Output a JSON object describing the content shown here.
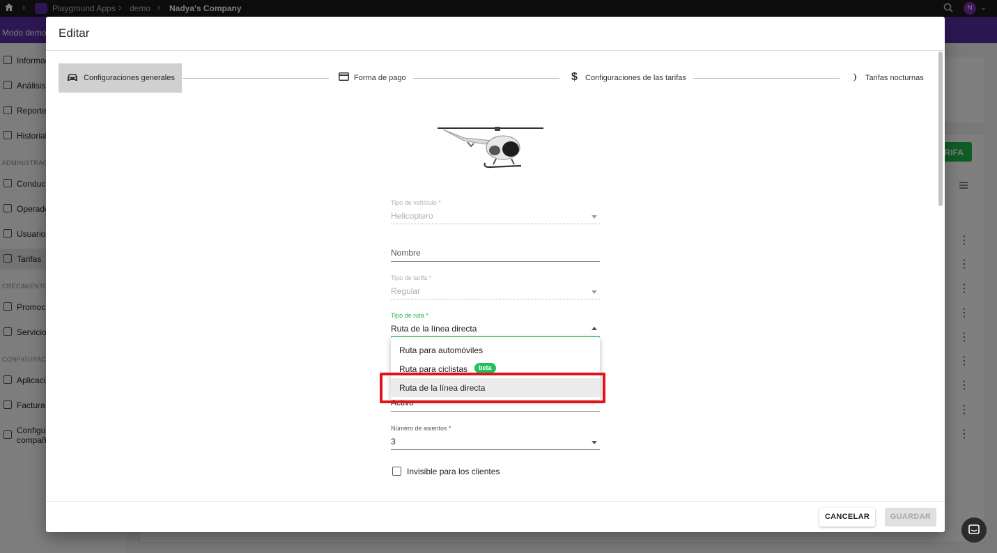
{
  "topbar": {
    "home_icon": "home-icon",
    "crumbs": [
      "Playground Apps",
      "demo",
      "Nadya's Company"
    ],
    "avatar_letter": "N"
  },
  "banner": {
    "text": "Modo demo,"
  },
  "sidebar": {
    "items": [
      {
        "label": "Informac",
        "icon": "dashboard-icon"
      },
      {
        "label": "Análisis",
        "icon": "bar-chart-icon"
      },
      {
        "label": "Reportes",
        "icon": "report-icon"
      },
      {
        "label": "Historial",
        "icon": "history-icon"
      },
      {
        "label": "Conducto",
        "icon": "car-icon"
      },
      {
        "label": "Operado",
        "icon": "headset-icon"
      },
      {
        "label": "Usuarios",
        "icon": "users-icon"
      },
      {
        "label": "Tarifas",
        "icon": "tariff-icon"
      },
      {
        "label": "Promoci",
        "icon": "tag-icon"
      },
      {
        "label": "Servicios",
        "icon": "megaphone-icon"
      },
      {
        "label": "Aplicacio",
        "icon": "devices-icon"
      },
      {
        "label": "Factura",
        "icon": "invoice-icon"
      },
      {
        "label": "Configur",
        "label2": "compañí",
        "icon": "gear-icon"
      }
    ],
    "sections": [
      "ADMINISTRACI",
      "CRECIMIENTO",
      "CONFIGURACIÓ"
    ]
  },
  "background": {
    "green_button_label": "ARIFA"
  },
  "dialog": {
    "title": "Editar",
    "steps": [
      {
        "label": "Configuraciones generales",
        "icon": "car-icon"
      },
      {
        "label": "Forma de pago",
        "icon": "credit-card-icon"
      },
      {
        "label": "Configuraciones de las tarifas",
        "icon": "dollar-icon"
      },
      {
        "label": "Tarifas nocturnas",
        "icon": "moon-icon"
      }
    ],
    "vehicle_image": "helicopter-image",
    "fields": {
      "vehicle_type": {
        "label": "Tipo de vehículo *",
        "value": "Helicoptero"
      },
      "name": {
        "placeholder": "Nombre"
      },
      "tariff_type": {
        "label": "Tipo de tarifa *",
        "value": "Regular"
      },
      "route_type": {
        "label": "Tipo de ruta *",
        "value": "Ruta de la línea directa"
      },
      "status": {
        "value": "Activo"
      },
      "seats": {
        "label": "Número de asientos *",
        "value": "3"
      }
    },
    "route_options": [
      {
        "label": "Ruta para automóviles"
      },
      {
        "label": "Ruta para ciclistas",
        "badge": "beta"
      },
      {
        "label": "Ruta de la línea directa"
      }
    ],
    "invisible_checkbox": {
      "label": "Invisible para los clientes",
      "checked": false
    },
    "cancel_label": "CANCELAR",
    "save_label": "GUARDAR"
  },
  "colors": {
    "accent_green": "#1fc15a",
    "highlight_red": "#e0141b",
    "banner_purple": "#5b2ea6"
  }
}
